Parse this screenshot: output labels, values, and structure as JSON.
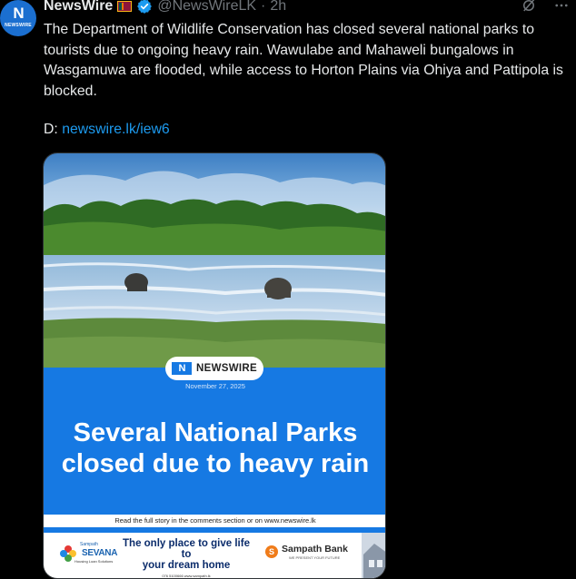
{
  "account": {
    "avatar_mono": "N",
    "avatar_brand": "NEWSWIRE",
    "display_name": "NewsWire",
    "handle": "@NewsWireLK",
    "separator": "·",
    "time": "2h"
  },
  "tweet": {
    "text": "The Department of Wildlife Conservation has closed several national parks to tourists due to ongoing heavy rain. Wawulabe and Mahaweli bungalows in Wasgamuwa are flooded, while access to Horton Plains via Ohiya and Pattipola is blocked.",
    "link_prefix": "D:",
    "link_text": "newswire.lk/iew6"
  },
  "media": {
    "brand_mono": "N",
    "brand": "NEWSWIRE",
    "date": "November 27, 2025",
    "headline_line1": "Several National Parks",
    "headline_line2": "closed due to heavy rain",
    "readmore": "Read the full story in the comments section or on www.newswire.lk",
    "ad": {
      "sevana_brand": "Sampath",
      "sevana": "SEVANA",
      "sevana_sub": "Housing Loan Solutions",
      "slogan": "The only place to give life to\nyour dream home",
      "contact": "076 5100666   www.sampath.lk",
      "bank": "Sampath Bank",
      "bank_tagline": "WE PRESENT YOUR FUTURE"
    }
  },
  "icons": [
    "verified-badge-icon",
    "grok-icon",
    "more-icon"
  ],
  "colors": {
    "link": "#1d9bf0",
    "muted": "#71767b",
    "panel_blue": "#1679e3",
    "verified": "#1d9bf0"
  }
}
